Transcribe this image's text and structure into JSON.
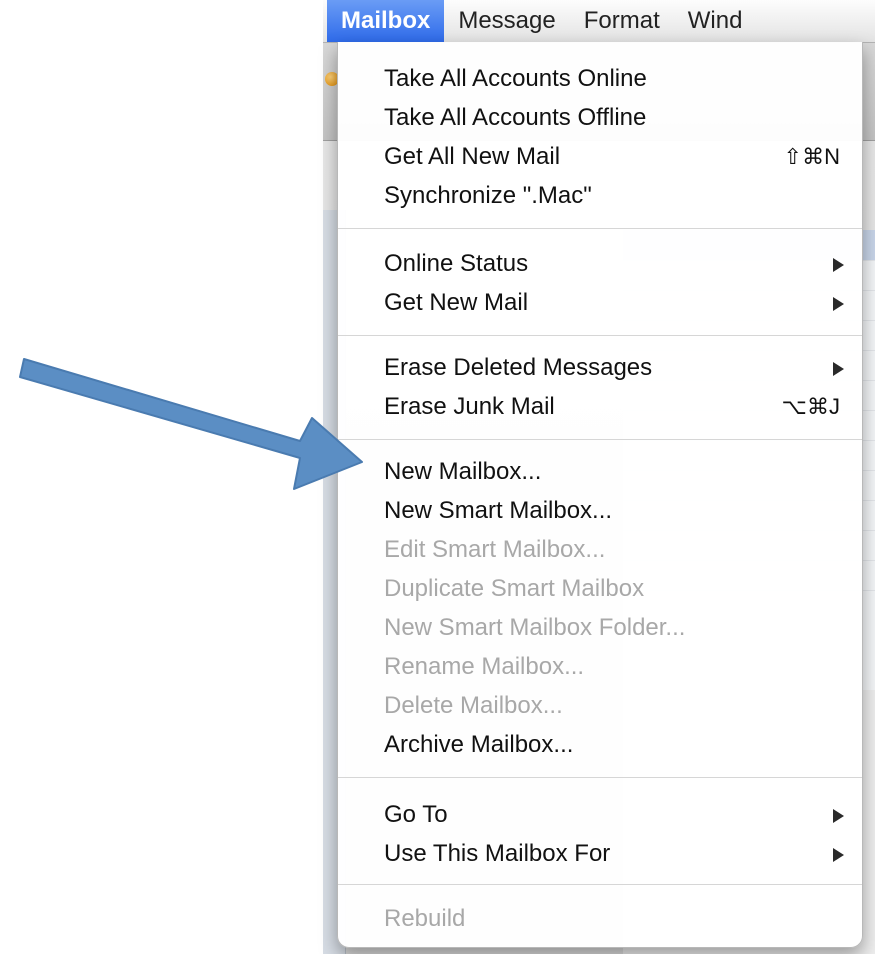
{
  "menubar": {
    "items": [
      "Mailbox",
      "Message",
      "Format",
      "Wind"
    ],
    "active_index": 0
  },
  "menu": {
    "items": [
      {
        "label": "Take All Accounts Online",
        "enabled": true
      },
      {
        "label": "Take All Accounts Offline",
        "enabled": true
      },
      {
        "label": "Get All New Mail",
        "enabled": true,
        "shortcut": "⇧⌘N"
      },
      {
        "label": "Synchronize \".Mac\"",
        "enabled": true
      },
      {
        "label": "Online Status",
        "enabled": true,
        "submenu": true
      },
      {
        "label": "Get New Mail",
        "enabled": true,
        "submenu": true
      },
      {
        "label": "Erase Deleted Messages",
        "enabled": true,
        "submenu": true
      },
      {
        "label": "Erase Junk Mail",
        "enabled": true,
        "shortcut": "⌥⌘J"
      },
      {
        "label": "New Mailbox...",
        "enabled": true
      },
      {
        "label": "New Smart Mailbox...",
        "enabled": true
      },
      {
        "label": "Edit Smart Mailbox...",
        "enabled": false
      },
      {
        "label": "Duplicate Smart Mailbox",
        "enabled": false
      },
      {
        "label": "New Smart Mailbox Folder...",
        "enabled": false
      },
      {
        "label": "Rename Mailbox...",
        "enabled": false
      },
      {
        "label": "Delete Mailbox...",
        "enabled": false
      },
      {
        "label": "Archive Mailbox...",
        "enabled": true
      },
      {
        "label": "Go To",
        "enabled": true,
        "submenu": true
      },
      {
        "label": "Use This Mailbox For",
        "enabled": true,
        "submenu": true
      },
      {
        "label": "Rebuild",
        "enabled": false
      }
    ]
  },
  "colors": {
    "menu_highlight": "#2f6bea",
    "annotation_arrow": "#5b8ec4",
    "disabled_text": "#a8a8a8"
  }
}
